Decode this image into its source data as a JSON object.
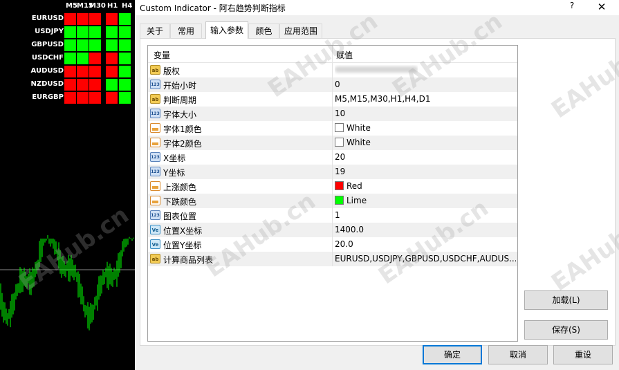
{
  "chart": {
    "timeframes": [
      "M5",
      "M15",
      "M30",
      "H1",
      "H4"
    ],
    "symbols": [
      "EURUSD",
      "USDJPY",
      "GBPUSD",
      "USDCHF",
      "AUDUSD",
      "NZDUSD",
      "EURGBP"
    ],
    "grid": [
      [
        "red",
        "red",
        "red",
        "red",
        "lime"
      ],
      [
        "lime",
        "lime",
        "lime",
        "lime",
        "lime"
      ],
      [
        "lime",
        "lime",
        "lime",
        "lime",
        "lime"
      ],
      [
        "lime",
        "lime",
        "red",
        "red",
        "lime"
      ],
      [
        "red",
        "red",
        "red",
        "red",
        "lime"
      ],
      [
        "red",
        "red",
        "red",
        "lime",
        "lime"
      ],
      [
        "red",
        "red",
        "red",
        "red",
        "lime"
      ]
    ],
    "colors": {
      "up": "#ff0000",
      "down": "#00ff00",
      "text": "#ffffff",
      "background": "#000000",
      "candles": "#00ff00"
    }
  },
  "dialog": {
    "title": "Custom Indicator - 阿右趋势判断指标",
    "help": "?",
    "close": "✕",
    "tabs": [
      {
        "label": "关于",
        "active": false
      },
      {
        "label": "常用",
        "active": false
      },
      {
        "label": "输入参数",
        "active": true
      },
      {
        "label": "颜色",
        "active": false
      },
      {
        "label": "应用范围",
        "active": false
      }
    ],
    "columns": {
      "variable": "变量",
      "value": "赋值"
    },
    "params": [
      {
        "icon": "ab",
        "icon_text": "ab",
        "name": "版权",
        "value": "",
        "value_blurred": true
      },
      {
        "icon": "n123",
        "icon_text": "123",
        "name": "开始小时",
        "value": "0"
      },
      {
        "icon": "ab",
        "icon_text": "ab",
        "name": "判断周期",
        "value": "M5,M15,M30,H1,H4,D1"
      },
      {
        "icon": "n123",
        "icon_text": "123",
        "name": "字体大小",
        "value": "10"
      },
      {
        "icon": "clr",
        "icon_text": "",
        "name": "字体1颜色",
        "value": "White",
        "swatch": "#ffffff"
      },
      {
        "icon": "clr",
        "icon_text": "",
        "name": "字体2颜色",
        "value": "White",
        "swatch": "#ffffff"
      },
      {
        "icon": "n123",
        "icon_text": "123",
        "name": "X坐标",
        "value": "20"
      },
      {
        "icon": "n123",
        "icon_text": "123",
        "name": "Y坐标",
        "value": "19"
      },
      {
        "icon": "clr",
        "icon_text": "",
        "name": "上涨颜色",
        "value": "Red",
        "swatch": "#ff0000"
      },
      {
        "icon": "clr",
        "icon_text": "",
        "name": "下跌颜色",
        "value": "Lime",
        "swatch": "#00ff00"
      },
      {
        "icon": "n123",
        "icon_text": "123",
        "name": "图表位置",
        "value": "1"
      },
      {
        "icon": "ve",
        "icon_text": "Ve",
        "name": "位置X坐标",
        "value": "1400.0"
      },
      {
        "icon": "ve",
        "icon_text": "Ve",
        "name": "位置Y坐标",
        "value": "20.0"
      },
      {
        "icon": "ab",
        "icon_text": "ab",
        "name": "计算商品列表",
        "value": "EURUSD,USDJPY,GBPUSD,USDCHF,AUDUS..."
      }
    ],
    "buttons": {
      "load": "加载(L)",
      "save": "保存(S)",
      "ok": "确定",
      "cancel": "取消",
      "reset": "重设"
    },
    "watermark": "EAHub.cn",
    "colors": {
      "focus": "#0078d7",
      "row_alt": "#f0f0f0",
      "dialog_bg": "#f0f0f0"
    }
  }
}
